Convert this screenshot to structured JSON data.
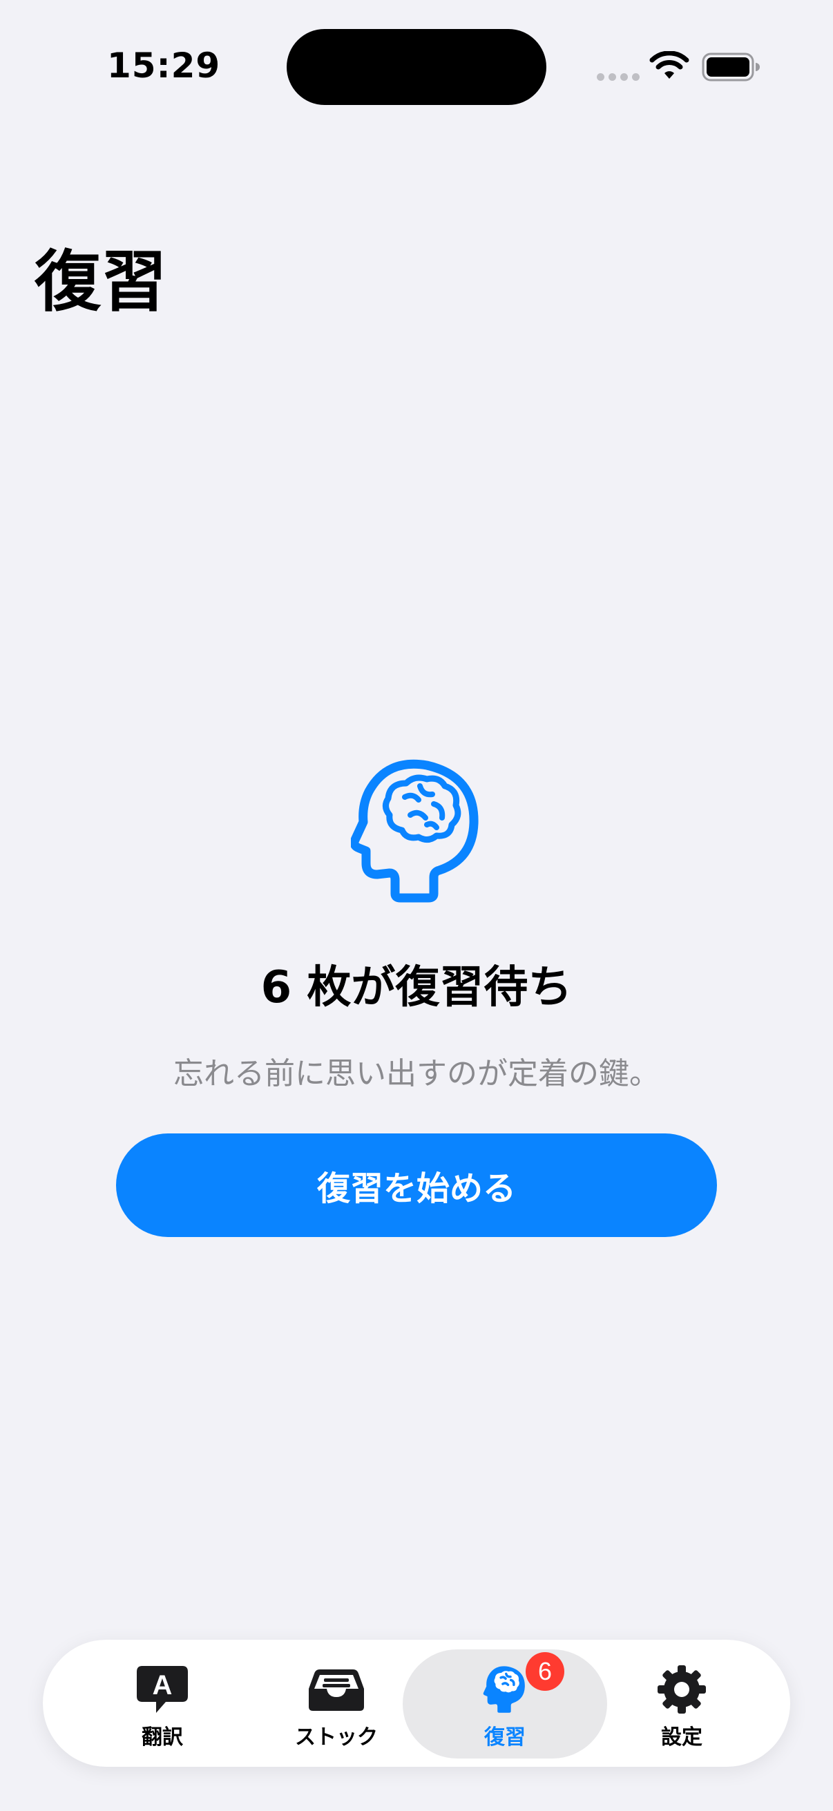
{
  "status_bar": {
    "time": "15:29"
  },
  "page": {
    "title": "復習"
  },
  "review": {
    "icon": "brain-head-icon",
    "title": "6 枚が復習待ち",
    "subtitle": "忘れる前に思い出すのが定着の鍵。",
    "start_label": "復習を始める"
  },
  "tab_bar": {
    "items": [
      {
        "label": "翻訳",
        "icon": "translate-bubble-icon"
      },
      {
        "label": "ストック",
        "icon": "tray-icon"
      },
      {
        "label": "復習",
        "icon": "brain-head-icon",
        "badge": "6",
        "active": true
      },
      {
        "label": "設定",
        "icon": "gear-icon"
      }
    ]
  },
  "colors": {
    "accent": "#0a84ff",
    "background": "#f2f2f7",
    "badge": "#ff3b30",
    "secondary_text": "#8a8a8e"
  }
}
